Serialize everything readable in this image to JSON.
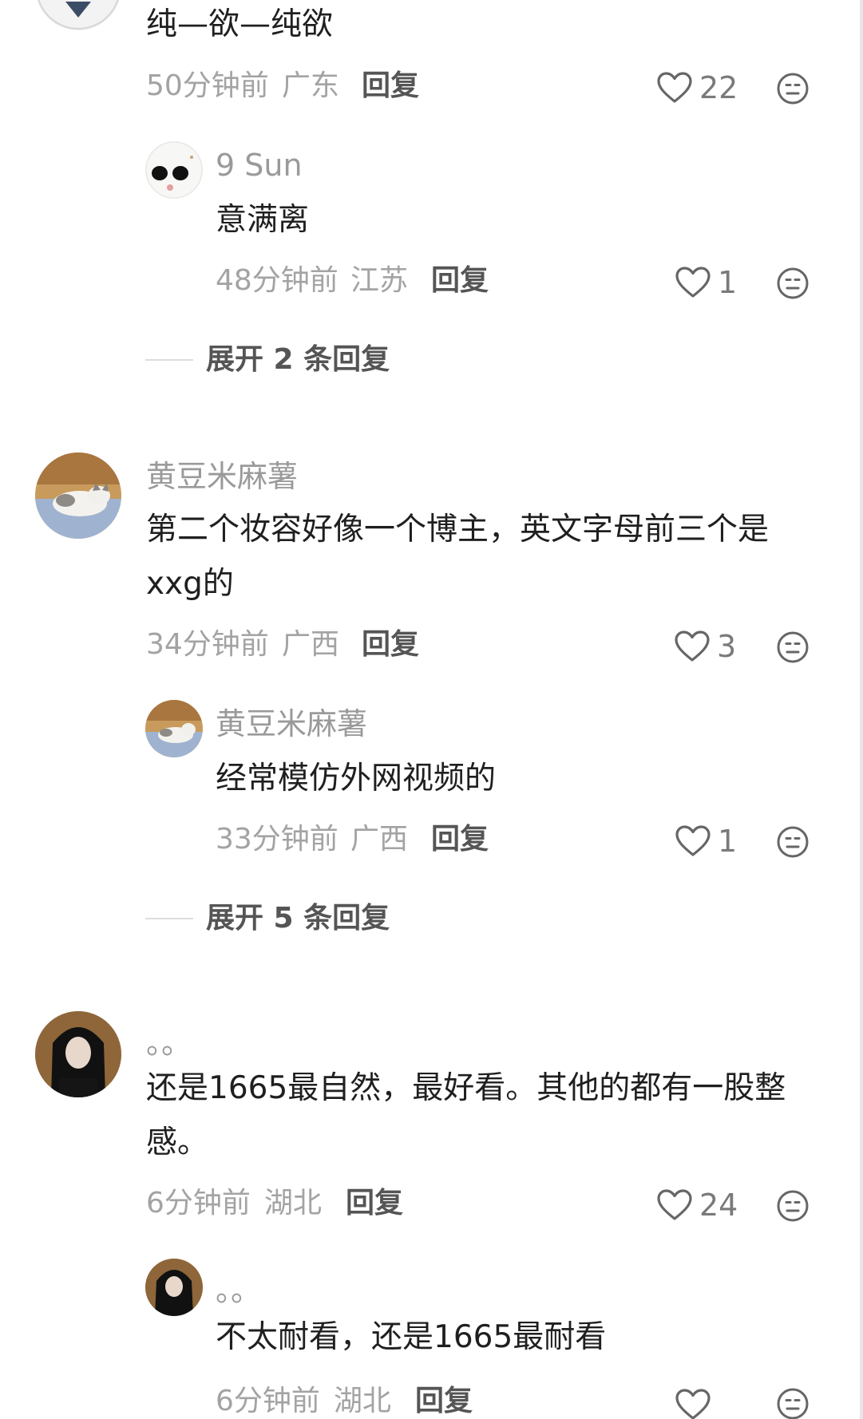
{
  "comments": [
    {
      "content_lines": [
        "纯—欲—纯欲"
      ],
      "time": "50分钟前",
      "location": "广东",
      "reply_label": "回复",
      "likes": "22",
      "replies": [
        {
          "username": "9 Sun",
          "content_lines": [
            "意满离"
          ],
          "time": "48分钟前",
          "location": "江苏",
          "reply_label": "回复",
          "likes": "1"
        }
      ],
      "expand_label": "展开 2 条回复"
    },
    {
      "username": "黄豆米麻薯",
      "content_lines": [
        "第二个妆容好像一个博主，英文字母前三个是",
        "xxg的"
      ],
      "time": "34分钟前",
      "location": "广西",
      "reply_label": "回复",
      "likes": "3",
      "replies": [
        {
          "username": "黄豆米麻薯",
          "content_lines": [
            "经常模仿外网视频的"
          ],
          "time": "33分钟前",
          "location": "广西",
          "reply_label": "回复",
          "likes": "1"
        }
      ],
      "expand_label": "展开 5 条回复"
    },
    {
      "username": "。。",
      "content_lines": [
        "还是1665最自然，最好看。其他的都有一股整",
        "感。"
      ],
      "time": "6分钟前",
      "location": "湖北",
      "reply_label": "回复",
      "likes": "24",
      "replies": [
        {
          "username": "。。",
          "content_lines": [
            "不太耐看，还是1665最耐看"
          ],
          "time": "6分钟前",
          "location": "湖北",
          "reply_label": "回复"
        }
      ]
    }
  ],
  "icons": {
    "like": "heart-outline-icon",
    "emoji": "emoji-face-icon"
  },
  "colors": {
    "meta_text": "#a3a3a3",
    "username_text": "#9a9a9a",
    "content_text": "#1f1f1f",
    "action_text": "#555555"
  }
}
